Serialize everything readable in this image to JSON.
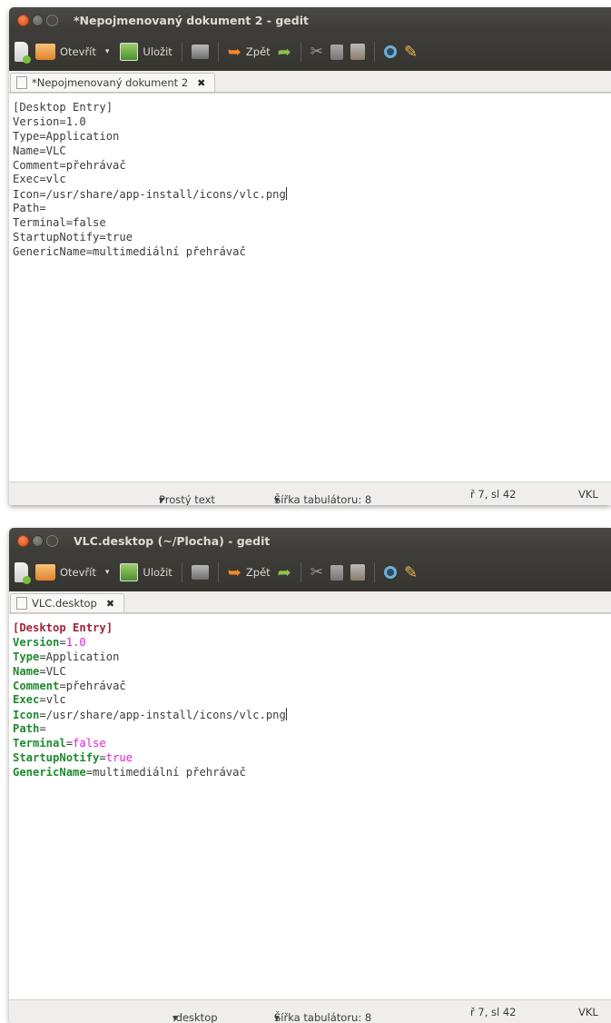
{
  "toolbar": {
    "open_label": "Otevřít",
    "save_label": "Uložit",
    "undo_label": "Zpět"
  },
  "windows": [
    {
      "title": "*Nepojmenovaný dokument 2 - gedit",
      "tab_label": "*Nepojmenovaný dokument 2",
      "lines": [
        "[Desktop Entry]",
        "Version=1.0",
        "Type=Application",
        "Name=VLC",
        "Comment=přehrávač",
        "Exec=vlc",
        "Icon=/usr/share/app-install/icons/vlc.png",
        "Path=",
        "Terminal=false",
        "StartupNotify=true",
        "GenericName=multimediální přehrávač"
      ],
      "status": {
        "language": "Prostý text",
        "tab_width": "Šířka tabulátoru: 8",
        "position": "ř 7, sl 42",
        "mode": "VKL"
      }
    },
    {
      "title": "VLC.desktop (~/Plocha) - gedit",
      "tab_label": "VLC.desktop",
      "lines": [
        "[Desktop Entry]",
        "Version=1.0",
        "Type=Application",
        "Name=VLC",
        "Comment=přehrávač",
        "Exec=vlc",
        "Icon=/usr/share/app-install/icons/vlc.png",
        "Path=",
        "Terminal=false",
        "StartupNotify=true",
        "GenericName=multimediální přehrávač"
      ],
      "status": {
        "language": ".desktop",
        "tab_width": "Šířka tabulátoru: 8",
        "position": "ř 7, sl 42",
        "mode": "VKL"
      }
    }
  ],
  "syntax_colors": {
    "key": "#1e8a2e",
    "group_header": "#a5223a",
    "number_boolean": "#e020e0"
  }
}
